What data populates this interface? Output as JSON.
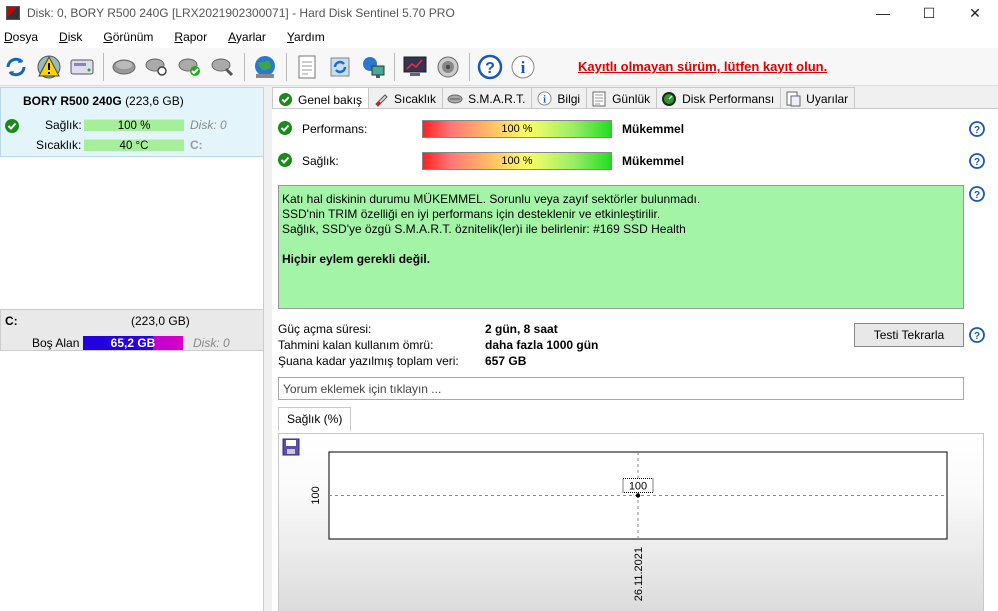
{
  "window": {
    "title": "Disk: 0, BORY R500 240G [LRX2021902300071]  -  Hard Disk Sentinel 5.70 PRO",
    "minimize": "—",
    "maximize": "☐",
    "close": "✕"
  },
  "menu": [
    {
      "pre": "D",
      "rest": "osya"
    },
    {
      "pre": "D",
      "rest": "isk"
    },
    {
      "pre": "G",
      "rest": "örünüm"
    },
    {
      "pre": "R",
      "rest": "apor"
    },
    {
      "pre": "A",
      "rest": "yarlar"
    },
    {
      "pre": "Y",
      "rest": "ardım"
    }
  ],
  "toolbar": {
    "registration_notice": "Kayıtlı olmayan sürüm, lütfen kayıt olun."
  },
  "disk": {
    "name": "BORY R500 240G",
    "size": "(223,6 GB)",
    "health_label": "Sağlık:",
    "health_value": "100 %",
    "health_pct": 100,
    "temp_label": "Sıcaklık:",
    "temp_value": "40 °C",
    "disk_ref": "Disk: 0",
    "drive_letter": "C:"
  },
  "volume": {
    "letter": "C:",
    "size": "(223,0 GB)",
    "free_label": "Boş Alan",
    "free_value": "65,2 GB",
    "disk_ref": "Disk: 0"
  },
  "tabs": [
    {
      "label": "Genel bakış",
      "icon": "check-circle-icon",
      "active": true
    },
    {
      "label": "Sıcaklık",
      "icon": "thermometer-icon"
    },
    {
      "label": "S.M.A.R.T.",
      "icon": "smart-icon"
    },
    {
      "label": "Bilgi",
      "icon": "info-icon"
    },
    {
      "label": "Günlük",
      "icon": "log-icon"
    },
    {
      "label": "Disk Performansı",
      "icon": "speedometer-icon"
    },
    {
      "label": "Uyarılar",
      "icon": "warning-doc-icon"
    }
  ],
  "overview": {
    "performance_label": "Performans:",
    "performance_value": "100 %",
    "performance_pct": 100,
    "performance_rating": "Mükemmel",
    "health_label": "Sağlık:",
    "health_value": "100 %",
    "health_pct": 100,
    "health_rating": "Mükemmel",
    "status_lines": [
      "Katı hal diskinin durumu MÜKEMMEL. Sorunlu veya zayıf sektörler bulunmadı.",
      "SSD'nin TRIM özelliği en iyi performans için desteklenir ve etkinleştirilir.",
      "Sağlık, SSD'ye özgü S.M.A.R.T. öznitelik(ler)i ile belirlenir:  #169 SSD Health"
    ],
    "status_action": "Hiçbir eylem gerekli değil.",
    "power_on_label": "Güç açma süresi:",
    "power_on_value": "2 gün, 8 saat",
    "remaining_life_label": "Tahmini kalan kullanım ömrü:",
    "remaining_life_value": "daha fazla 1000 gün",
    "total_written_label": "Şuana kadar yazılmış toplam veri:",
    "total_written_value": "657 GB",
    "retest_button": "Testi Tekrarla",
    "comment_placeholder": "Yorum eklemek için tıklayın ..."
  },
  "chart_tab_label": "Sağlık (%)",
  "chart_data": {
    "type": "line",
    "x": [
      "26.11.2021"
    ],
    "series": [
      {
        "values": [
          100
        ]
      }
    ],
    "ylabel": "",
    "y_tick_labels": [
      "100"
    ],
    "data_labels": [
      "100"
    ],
    "grid": true
  }
}
